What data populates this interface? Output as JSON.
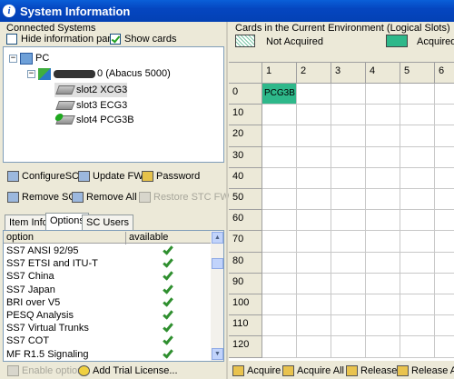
{
  "window": {
    "title": "System Information"
  },
  "connected_systems": {
    "label": "Connected Systems",
    "hide_info_pane": {
      "label": "Hide information pane",
      "checked": false
    },
    "show_cards": {
      "label": "Show cards",
      "checked": true
    },
    "tree": {
      "root": "PC",
      "system_label": "(Abacus 5000)",
      "system_suffix": "0",
      "slots": [
        "slot2 XCG3",
        "slot3 ECG3",
        "slot4 PCG3B"
      ]
    }
  },
  "actions": {
    "configure": "ConfigureSC",
    "update_fw": "Update FW",
    "password": "Password",
    "remove_sc": "Remove SC",
    "remove_all": "Remove All",
    "restore_stc_fw": "Restore STC FW"
  },
  "tabs": [
    "Item Info",
    "Options",
    "SC Users"
  ],
  "options_table": {
    "headers": [
      "option",
      "available"
    ],
    "rows": [
      "SS7 ANSI 92/95",
      "SS7 ETSI and ITU-T",
      "SS7 China",
      "SS7 Japan",
      "BRI over V5",
      "PESQ Analysis",
      "SS7 Virtual Trunks",
      "SS7 COT",
      "MF R1.5 Signaling"
    ]
  },
  "bottom_left": {
    "enable_option": "Enable option",
    "add_trial": "Add Trial License..."
  },
  "cards_panel": {
    "label": "Cards in the Current Environment (Logical Slots)",
    "legend_not_acquired": "Not Acquired",
    "legend_acquired": "Acquired",
    "acquired_color": "#2EB88A",
    "columns": [
      "1",
      "2",
      "3",
      "4",
      "5",
      "6"
    ],
    "rows": [
      "0",
      "10",
      "20",
      "30",
      "40",
      "50",
      "60",
      "70",
      "80",
      "90",
      "100",
      "110",
      "120"
    ],
    "card": {
      "label": "PCG3B",
      "row": "0",
      "col": "1"
    }
  },
  "bottom_right": {
    "acquire": "Acquire",
    "acquire_all": "Acquire All",
    "release": "Release",
    "release_all": "Release All"
  }
}
